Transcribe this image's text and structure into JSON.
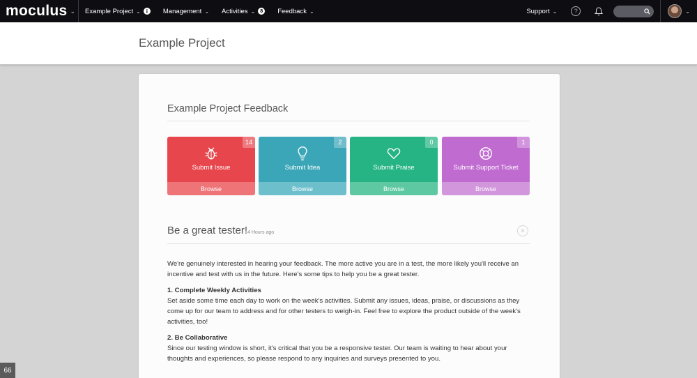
{
  "nav": {
    "brand": "moculus",
    "items": [
      {
        "label": "Example Project",
        "has_info": true
      },
      {
        "label": "Management"
      },
      {
        "label": "Activities",
        "badge": "8"
      },
      {
        "label": "Feedback"
      }
    ],
    "support_label": "Support",
    "help_icon": "question-circle-icon",
    "bell_icon": "bell-icon",
    "search_icon": "search-icon"
  },
  "header": {
    "title": "Example Project"
  },
  "feedback": {
    "heading": "Example Project Feedback",
    "tiles": [
      {
        "label": "Submit Issue",
        "count": "14",
        "browse": "Browse",
        "icon": "bug-icon",
        "color_top": "#e8464d",
        "color_bottom": "#ee7478"
      },
      {
        "label": "Submit Idea",
        "count": "2",
        "browse": "Browse",
        "icon": "lightbulb-icon",
        "color_top": "#3aa6b8",
        "color_bottom": "#6dbfcc"
      },
      {
        "label": "Submit Praise",
        "count": "0",
        "browse": "Browse",
        "icon": "heart-icon",
        "color_top": "#26b484",
        "color_bottom": "#5ec8a2"
      },
      {
        "label": "Submit Support Ticket",
        "count": "1",
        "browse": "Browse",
        "icon": "lifebuoy-icon",
        "color_top": "#c06bd0",
        "color_bottom": "#d196dc"
      }
    ]
  },
  "post": {
    "title": "Be a great tester!",
    "time": "4 Hours ago",
    "intro": "We're genuinely interested in hearing your feedback.  The more active you are in a test, the more likely you'll receive an incentive and test with us in the future. Here's some tips to help you be a great tester.",
    "s1_heading": "1. Complete Weekly Activities",
    "s1_body": "Set aside some time each day to work on the week's activities. Submit any issues, ideas, praise, or discussions as they come up for our team to address and for other testers to weigh-in.  Feel free to explore the product outside of the week's activities, too!",
    "s2_heading": "2. Be Collaborative",
    "s2_body": "Since our testing window is short, it's critical that you be a responsive tester. Our team is waiting to hear about your thoughts and experiences, so please respond to any inquiries and surveys presented to you."
  },
  "corner_badge": "66"
}
